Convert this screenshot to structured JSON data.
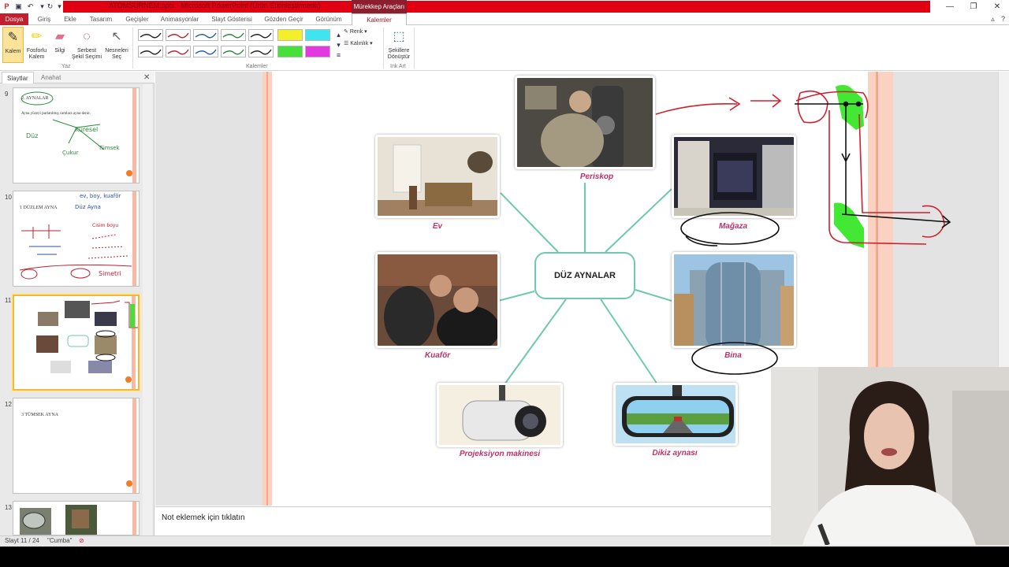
{
  "titlebar": {
    "title": "ATOMSURNEM.pptx - Microsoft PowerPoint (Ürün Etkinleştirmede)",
    "context_tab_header": "Mürekkep Araçları"
  },
  "tabs": [
    "Dosya",
    "Giriş",
    "Ekle",
    "Tasarım",
    "Geçişler",
    "Animasyonlar",
    "Slayt Gösterisi",
    "Gözden Geçir",
    "Görünüm",
    "Kalemler"
  ],
  "ribbon": {
    "write_buttons": [
      "Kalem",
      "Fosforlu Kalem",
      "Silgi",
      "Serbest Şekil Seçimi",
      "Nesneleri Seç"
    ],
    "group_write": "Yaz",
    "group_pens": "Kalemler",
    "color_label": "Renk",
    "thickness_label": "Kalınlık",
    "convert_label": "Şekillere Dönüştür",
    "group_ink_art": "Ink Art",
    "pen_colors": [
      "#222222",
      "#c0202f",
      "#1f5fa8",
      "#2a8a3a",
      "#222222"
    ],
    "highlighter_colors": [
      "#f5ef2a",
      "#3ee4f0",
      "#46e03a",
      "#e23ae0"
    ]
  },
  "left_panel": {
    "tab_slides": "Slaytlar",
    "tab_outline": "Anahat",
    "slides": [
      {
        "num": "9",
        "title": "2. AYNALAR",
        "text": "Ayna yüzeyi parlatılmış camlara ayna denir.",
        "ink": [
          "Düz",
          "Küresel",
          "Çukur",
          "Tümsek"
        ]
      },
      {
        "num": "10",
        "title": "1 DÜZLEM AYNA",
        "ink": [
          "ev, boy, kuaför",
          "Düz Ayna",
          "Cisim boyu",
          "Simetri"
        ]
      },
      {
        "num": "11",
        "title": ""
      },
      {
        "num": "12",
        "title": "3 TÜMSEK AYNA"
      },
      {
        "num": "13",
        "title": ""
      }
    ]
  },
  "slide": {
    "center": "DÜZ AYNALAR",
    "captions": {
      "periskop": "Periskop",
      "ev": "Ev",
      "magaza": "Mağaza",
      "kuafor": "Kuaför",
      "bina": "Bina",
      "projeksiyon": "Projeksiyon makinesi",
      "dikiz": "Dikiz aynası"
    }
  },
  "notes": {
    "placeholder": "Not eklemek için tıklatın"
  },
  "status": {
    "slide_counter": "Slayt 11 / 24",
    "theme": "\"Cumba\""
  }
}
